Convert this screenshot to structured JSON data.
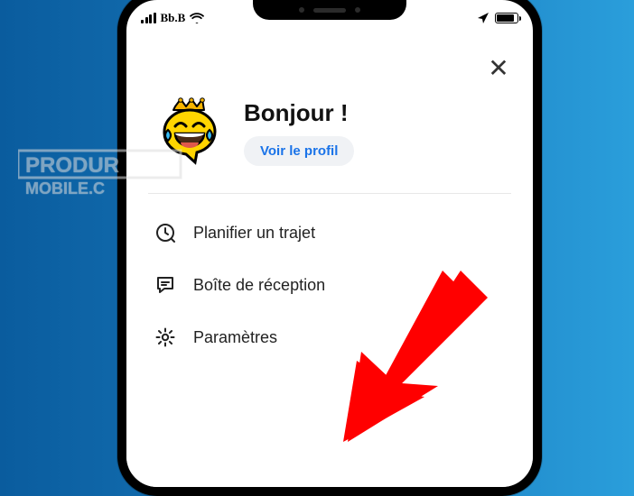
{
  "status": {
    "carrier": "Bb.B"
  },
  "close_label": "✕",
  "profile": {
    "greeting": "Bonjour !",
    "view_profile": "Voir le profil"
  },
  "menu": {
    "plan": "Planifier un trajet",
    "inbox": "Boîte de réception",
    "settings": "Paramètres"
  },
  "watermark": {
    "line1": "PRODUR",
    "line2": "MOBILE.C"
  }
}
